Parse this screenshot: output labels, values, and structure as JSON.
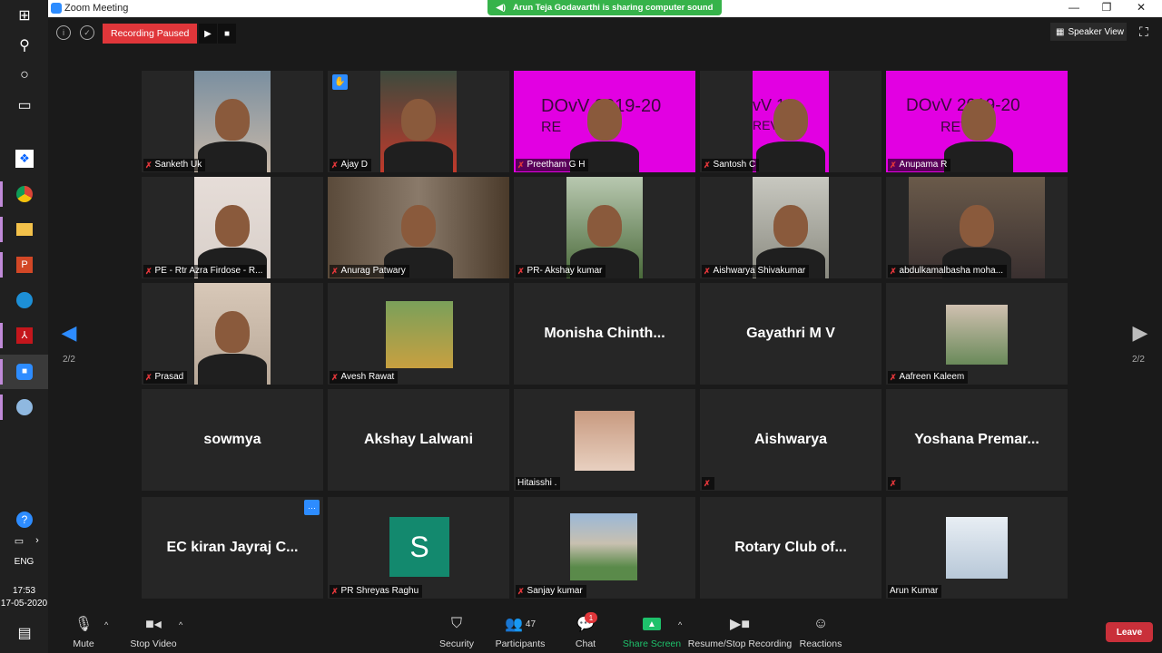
{
  "window": {
    "title": "Zoom Meeting",
    "minimize": "—",
    "maximize": "❐",
    "close": "✕"
  },
  "share_banner": "Arun Teja Godavarthi is sharing computer sound",
  "topbar": {
    "recording": "Recording Paused",
    "speaker_view": "Speaker View"
  },
  "pagination": {
    "left": "2/2",
    "right": "2/2"
  },
  "tiles": {
    "t1": "Sanketh Uk",
    "t2": "Ajay D",
    "t3": "Preetham G H",
    "t3_banner": "DOvV 2019-20",
    "t3_banner2": "RE",
    "t4": "Santosh C",
    "t4_banner": "vV 19",
    "t4_banner2": "REVI E",
    "t5": "Anupama R",
    "t5_banner": "DOvV 2019-20",
    "t5_banner2": "REV",
    "t6": "PE - Rtr Azra Firdose - R...",
    "t7": "Anurag Patwary",
    "t8": "PR- Akshay kumar",
    "t9": "Aishwarya Shivakumar",
    "t10": "abdulkamalbasha moha...",
    "t11": "Prasad",
    "t12": "Avesh Rawat",
    "t13": "Monisha  Chinth...",
    "t14": "Gayathri M V",
    "t15": "Aafreen Kaleem",
    "t16": "sowmya",
    "t17": "Akshay Lalwani",
    "t18": "Hitaisshi .",
    "t19": "Aishwarya",
    "t20": "Yoshana  Premar...",
    "t21": "EC kiran Jayraj C...",
    "t22": "PR Shreyas Raghu",
    "t22_avatar": "S",
    "t23": "Sanjay kumar",
    "t24": "Rotary Club of...",
    "t25": "Arun Kumar"
  },
  "toolbar": {
    "mute": "Mute",
    "stop_video": "Stop Video",
    "security": "Security",
    "participants": "Participants",
    "participants_count": "47",
    "chat": "Chat",
    "chat_badge": "1",
    "share_screen": "Share Screen",
    "record": "Resume/Stop Recording",
    "reactions": "Reactions",
    "leave": "Leave"
  },
  "taskbar": {
    "lang": "ENG",
    "time": "17:53",
    "date": "17-05-2020"
  },
  "colors": {
    "zoom_blue": "#2d8cff",
    "record_red": "#e0363a",
    "share_green": "#36b34a",
    "banner_magenta": "#e200e2"
  }
}
